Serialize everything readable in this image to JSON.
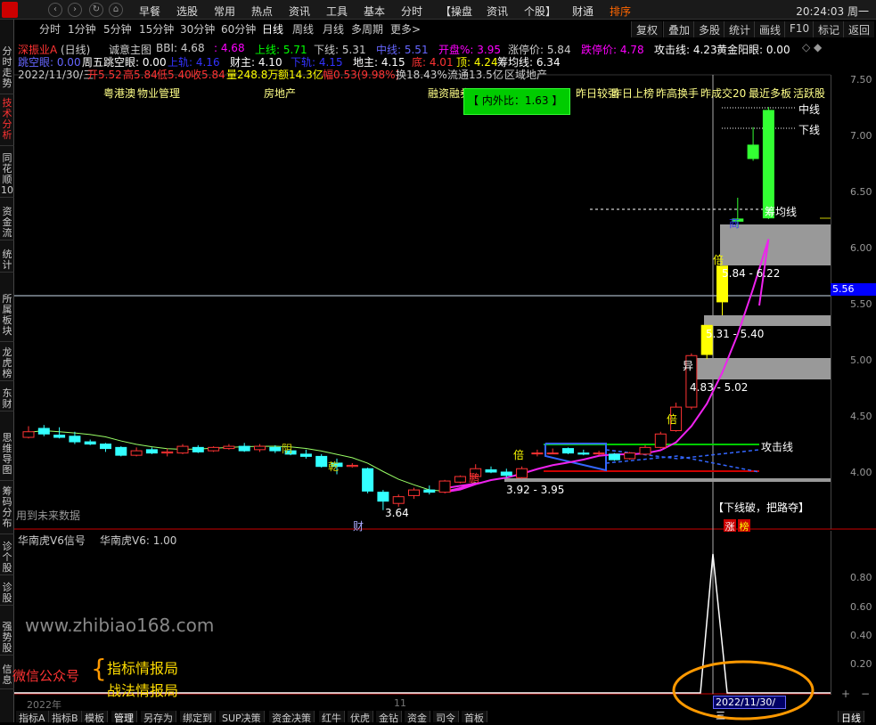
{
  "topbar": {
    "menus": [
      "早餐",
      "选股",
      "常用",
      "热点",
      "资讯",
      "工具",
      "基本",
      "分时",
      "【操盘",
      "资讯",
      "个股】",
      "财通",
      "排序"
    ],
    "clock": "20:24:03 周一"
  },
  "sidebar": {
    "tabs": [
      "分时走势",
      "技术分析",
      "同花顺10",
      "资金流",
      "统计",
      "所属板块",
      "龙虎榜",
      "东财",
      "思维导图",
      "筹码分布",
      "诊个股",
      "诊股",
      "强势股",
      "信息"
    ]
  },
  "periods": [
    "分时",
    "1分钟",
    "5分钟",
    "15分钟",
    "30分钟",
    "60分钟",
    "日线",
    "周线",
    "月线",
    "多周期",
    "更多>"
  ],
  "right_tabs": [
    "复权",
    "叠加",
    "多股",
    "统计",
    "画线",
    "F10",
    "标记",
    "返回"
  ],
  "line1": {
    "stock": "深振业A",
    "cycle": "(日线)",
    "indicator": "诚意主图",
    "bbi": "BBI: 4.68",
    "bbi2": ": 4.68",
    "upper": "上线: 5.71",
    "lower": "下线: 5.31",
    "mid": "中线: 5.51",
    "openpct": "开盘%: 3.95",
    "limitup": "涨停价: 5.84",
    "limitdown": "跌停价: 4.78",
    "attack": "攻击线: 4.23",
    "golden": "黄金阳眼: 0.00"
  },
  "line2": {
    "jump": "跳空眼: 0.00",
    "week": "周五跳空眼: 0.00",
    "up2": "上轨: 4.16",
    "cai": "财主: 4.10",
    "down2": "下轨: 4.15",
    "di": "地主: 4.15",
    "bottom": "底: 4.01",
    "top": "顶: 4.24",
    "chip": "筹均线: 6.34"
  },
  "line3": {
    "date": "2022/11/30/三",
    "open": "开5.52",
    "high": "高5.84",
    "low": "低5.40",
    "close": "收5.84",
    "vol": "量248.8万",
    "amt": "额14.3亿",
    "amp": "幅0.53(9.98%)",
    "turn": "换18.43%",
    "flow": "流通13.5亿",
    "region": "区域地产"
  },
  "concepts": [
    "粤港澳",
    "物业管理",
    "房地产",
    "融资融券",
    "昨日较强",
    "昨日上榜",
    "昨高换手",
    "昨成交20",
    "最近多板",
    "活跃股"
  ],
  "inner_outer": "【 内外比：1.63 】",
  "price_axis": [
    "7.50",
    "7.00",
    "6.50",
    "6.00",
    "5.50",
    "5.00",
    "4.50",
    "4.00"
  ],
  "current_price": "5.56",
  "labels": {
    "zhongxian": "中线",
    "xiaxian": "下线",
    "choujun": "筹均线",
    "attack_line": "攻击线",
    "range1": "5.84 - 6.22",
    "range2": "5.31 - 5.40",
    "range3": "4.83 - 5.02",
    "range4": "3.92 - 3.95",
    "low_mark": "3.64",
    "future": "用到未来数据",
    "breakdown": "【下线破，把路夺】",
    "zhang": "涨",
    "bang": "榜",
    "bei1": "倍",
    "bei2": "倍",
    "bei3": "倍",
    "yi": "异",
    "yang": "阴",
    "qian": "乾",
    "cai_mark": "财",
    "peng": "鹏",
    "shang": "商"
  },
  "sub_indicator": {
    "name": "华南虎V6信号",
    "value": "华南虎V6: 1.00",
    "axis": [
      "0.80",
      "0.60",
      "0.40",
      "0.20"
    ]
  },
  "watermark": {
    "site": "www.zhibiao168.com",
    "wechat": "微信公众号",
    "name1": "指标情报局",
    "name2": "战法情报局"
  },
  "date_tag": "2022/11/30/三",
  "bottom_axis": [
    "2022年",
    "11"
  ],
  "footer_tabs": [
    "指标A",
    "指标B",
    "模板",
    "管理",
    "另存为",
    "绑定到",
    "SUP决策",
    "资金决策",
    "红牛",
    "伏虎",
    "金钻",
    "资金",
    "司令",
    "首板"
  ],
  "footer_right": "日线",
  "chart_data": {
    "type": "candlestick",
    "ylim": [
      3.55,
      7.62
    ],
    "candles": [
      {
        "o": 4.31,
        "c": 4.36,
        "h": 4.41,
        "l": 4.3
      },
      {
        "o": 4.39,
        "c": 4.34,
        "h": 4.42,
        "l": 4.32
      },
      {
        "o": 4.33,
        "c": 4.31,
        "h": 4.4,
        "l": 4.3
      },
      {
        "o": 4.32,
        "c": 4.27,
        "h": 4.36,
        "l": 4.25
      },
      {
        "o": 4.27,
        "c": 4.25,
        "h": 4.29,
        "l": 4.24
      },
      {
        "o": 4.25,
        "c": 4.21,
        "h": 4.26,
        "l": 4.18
      },
      {
        "o": 4.22,
        "c": 4.15,
        "h": 4.23,
        "l": 4.14
      },
      {
        "o": 4.15,
        "c": 4.19,
        "h": 4.22,
        "l": 4.14
      },
      {
        "o": 4.2,
        "c": 4.17,
        "h": 4.22,
        "l": 4.16
      },
      {
        "o": 4.17,
        "c": 4.18,
        "h": 4.21,
        "l": 4.14
      },
      {
        "o": 4.17,
        "c": 4.23,
        "h": 4.25,
        "l": 4.16
      },
      {
        "o": 4.22,
        "c": 4.18,
        "h": 4.24,
        "l": 4.17
      },
      {
        "o": 4.19,
        "c": 4.22,
        "h": 4.23,
        "l": 4.18
      },
      {
        "o": 4.21,
        "c": 4.23,
        "h": 4.25,
        "l": 4.2
      },
      {
        "o": 4.23,
        "c": 4.19,
        "h": 4.26,
        "l": 4.18
      },
      {
        "o": 4.2,
        "c": 4.23,
        "h": 4.25,
        "l": 4.18
      },
      {
        "o": 4.22,
        "c": 4.19,
        "h": 4.24,
        "l": 4.17
      },
      {
        "o": 4.19,
        "c": 4.16,
        "h": 4.2,
        "l": 4.15
      },
      {
        "o": 4.16,
        "c": 4.14,
        "h": 4.2,
        "l": 4.12
      },
      {
        "o": 4.14,
        "c": 4.05,
        "h": 4.16,
        "l": 4.04
      },
      {
        "o": 4.08,
        "c": 4.05,
        "h": 4.12,
        "l": 3.98
      },
      {
        "o": 4.05,
        "c": 4.06,
        "h": 4.08,
        "l": 4.04
      },
      {
        "o": 4.03,
        "c": 3.83,
        "h": 4.04,
        "l": 3.81
      },
      {
        "o": 3.82,
        "c": 3.74,
        "h": 3.84,
        "l": 3.66
      },
      {
        "o": 3.72,
        "c": 3.78,
        "h": 3.8,
        "l": 3.69
      },
      {
        "o": 3.79,
        "c": 3.84,
        "h": 3.86,
        "l": 3.76
      },
      {
        "o": 3.84,
        "c": 3.82,
        "h": 3.88,
        "l": 3.8
      },
      {
        "o": 3.82,
        "c": 3.92,
        "h": 3.93,
        "l": 3.81
      },
      {
        "o": 3.91,
        "c": 3.96,
        "h": 3.97,
        "l": 3.9
      },
      {
        "o": 3.96,
        "c": 4.03,
        "h": 4.07,
        "l": 3.95
      },
      {
        "o": 4.02,
        "c": 4.0,
        "h": 4.05,
        "l": 3.99
      },
      {
        "o": 4.0,
        "c": 3.97,
        "h": 4.03,
        "l": 3.95
      },
      {
        "o": 3.95,
        "c": 4.03,
        "h": 4.05,
        "l": 3.94
      },
      {
        "o": 4.17,
        "c": 4.17,
        "h": 4.2,
        "l": 4.14
      },
      {
        "o": 4.17,
        "c": 4.17,
        "h": 4.21,
        "l": 4.16
      },
      {
        "o": 4.21,
        "c": 4.17,
        "h": 4.22,
        "l": 4.16
      },
      {
        "o": 4.17,
        "c": 4.16,
        "h": 4.2,
        "l": 4.15
      },
      {
        "o": 4.17,
        "c": 4.17,
        "h": 4.19,
        "l": 4.15
      },
      {
        "o": 4.16,
        "c": 4.11,
        "h": 4.17,
        "l": 4.1
      },
      {
        "o": 4.12,
        "c": 4.17,
        "h": 4.18,
        "l": 4.11
      },
      {
        "o": 4.16,
        "c": 4.22,
        "h": 4.24,
        "l": 4.15
      },
      {
        "o": 4.22,
        "c": 4.34,
        "h": 4.36,
        "l": 4.21
      },
      {
        "o": 4.37,
        "c": 4.58,
        "h": 4.62,
        "l": 4.36
      },
      {
        "o": 4.58,
        "c": 5.04,
        "h": 5.06,
        "l": 4.56
      },
      {
        "o": 5.05,
        "c": 5.31,
        "h": 5.31,
        "l": 5.01
      },
      {
        "o": 5.52,
        "c": 5.84,
        "h": 5.84,
        "l": 5.4
      },
      {
        "o": 6.24,
        "c": 6.26,
        "h": 6.45,
        "l": 6.18
      },
      {
        "o": 6.92,
        "c": 6.8,
        "h": 7.08,
        "l": 6.78
      },
      {
        "o": 6.27,
        "c": 7.23,
        "h": 7.26,
        "l": 6.26
      }
    ]
  }
}
